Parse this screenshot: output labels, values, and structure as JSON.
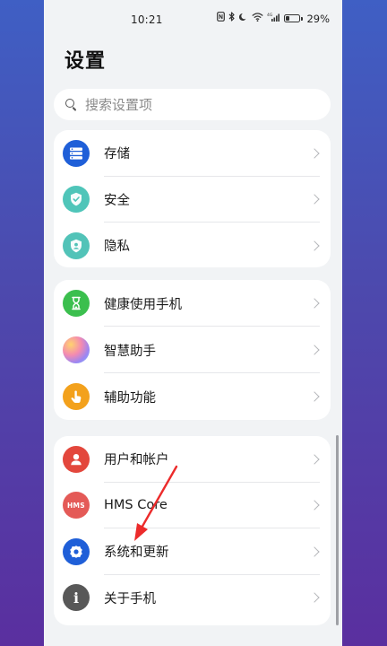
{
  "status_bar": {
    "time": "10:21",
    "icons": [
      "nfc-icon",
      "bluetooth-icon",
      "moon-icon",
      "wifi-icon",
      "signal-icon",
      "battery-icon"
    ],
    "battery_percent": "29%",
    "battery_level": 0.29
  },
  "header": {
    "title": "设置"
  },
  "search": {
    "placeholder": "搜索设置项"
  },
  "groups": [
    {
      "items": [
        {
          "label": "存储",
          "icon": "storage-icon",
          "color": "#1f5fd8"
        },
        {
          "label": "安全",
          "icon": "shield-icon",
          "color": "#4fc5b9"
        },
        {
          "label": "隐私",
          "icon": "privacy-icon",
          "color": "#52c3b8"
        }
      ]
    },
    {
      "items": [
        {
          "label": "健康使用手机",
          "icon": "hourglass-icon",
          "color": "#3bbf4e"
        },
        {
          "label": "智慧助手",
          "icon": "assistant-icon",
          "color": "#f08aa8"
        },
        {
          "label": "辅助功能",
          "icon": "hand-icon",
          "color": "#f3a11c"
        }
      ]
    },
    {
      "items": [
        {
          "label": "用户和帐户",
          "icon": "user-icon",
          "color": "#e3473c"
        },
        {
          "label": "HMS Core",
          "icon": "hms-icon",
          "color": "#e45a57",
          "badge": "HMS"
        },
        {
          "label": "系统和更新",
          "icon": "system-update-icon",
          "color": "#1f5fd8"
        },
        {
          "label": "关于手机",
          "icon": "info-icon",
          "color": "#585858",
          "badge": "i"
        }
      ]
    }
  ],
  "annotation": {
    "arrow_color": "#ec2b2b"
  }
}
